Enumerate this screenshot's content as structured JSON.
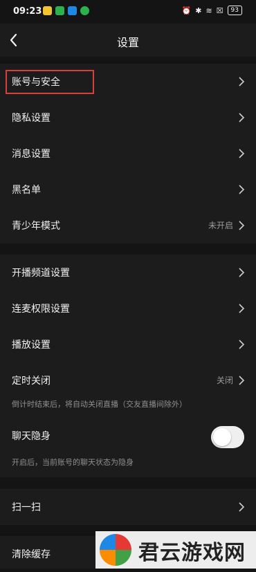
{
  "status_bar": {
    "time": "09:23",
    "battery": "93"
  },
  "header": {
    "title": "设置"
  },
  "group1": [
    {
      "label": "账号与安全",
      "value": ""
    },
    {
      "label": "隐私设置",
      "value": ""
    },
    {
      "label": "消息设置",
      "value": ""
    },
    {
      "label": "黑名单",
      "value": ""
    },
    {
      "label": "青少年模式",
      "value": "未开启"
    }
  ],
  "group2": [
    {
      "label": "开播频道设置",
      "value": ""
    },
    {
      "label": "连麦权限设置",
      "value": ""
    },
    {
      "label": "播放设置",
      "value": ""
    },
    {
      "label": "定时关闭",
      "value": "关闭"
    },
    {
      "label": "聊天隐身",
      "value": ""
    }
  ],
  "notes": {
    "timer": "倒计时结束后，将自动关闭直播（交友直播间除外）",
    "invisible": "开启后，当前账号的聊天状态为隐身"
  },
  "toggles": {
    "invisible_enabled": false
  },
  "group3": [
    {
      "label": "扫一扫",
      "value": ""
    }
  ],
  "group4": [
    {
      "label": "清除缓存",
      "value": ""
    }
  ],
  "watermark": {
    "text": "君云游戏网"
  },
  "colors": {
    "background": "#141414",
    "surface": "#1c1c1c",
    "highlight": "#d9403a"
  }
}
